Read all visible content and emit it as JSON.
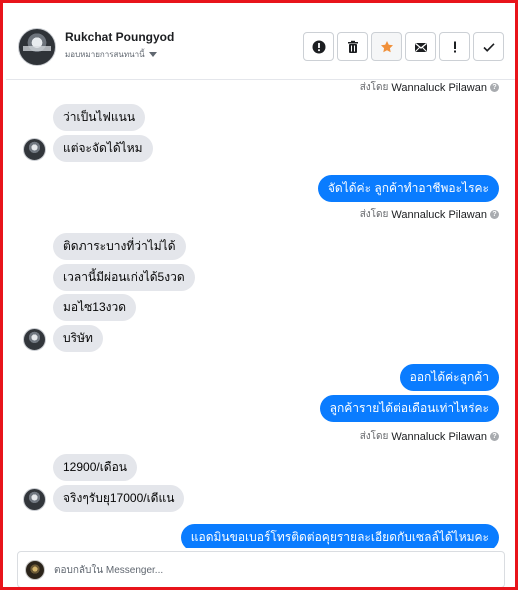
{
  "contact": {
    "name": "Rukchat Poungyod",
    "assign_label": "มอบหมายการสนทนานี้"
  },
  "toolbar": {
    "icons": [
      "alert-circle-icon",
      "trash-icon",
      "star-icon",
      "envelope-icon",
      "exclamation-icon",
      "check-icon"
    ],
    "accent_star": "#f0903a"
  },
  "thread": {
    "top_sent_by": {
      "prefix": "ส่งโดย",
      "name": "Wannaluck Pilawan"
    },
    "messages": [
      {
        "from": "customer",
        "text": "ว่าเป็นไฟแนน"
      },
      {
        "from": "customer",
        "text": "แต่จะจัดได้ไหม"
      },
      {
        "from": "page",
        "text": "จัดได้ค่ะ  ลูกค้าทำอาชีพอะไรคะ"
      },
      {
        "from": "customer",
        "text": "ติดภาระบางที่ว่าไม่ได้"
      },
      {
        "from": "customer",
        "text": "เวลานี้มีผ่อนเก่งได้5งวด"
      },
      {
        "from": "customer",
        "text": "มอไซ13งวด"
      },
      {
        "from": "customer",
        "text": "บริษัท"
      },
      {
        "from": "page",
        "text": "ออกได้ค่ะลูกค้า"
      },
      {
        "from": "page",
        "text": "ลูกค้ารายได้ต่อเดือนเท่าไหร่คะ"
      },
      {
        "from": "customer",
        "text": "12900/เดือน"
      },
      {
        "from": "customer",
        "text": "จริงๆรับยุ17000/เดีแน"
      },
      {
        "from": "page",
        "text": "แอดมินขอเบอร์โทรติดต่อคุยรายละเอียดกับเซลล์ได้ไหมคะ"
      }
    ],
    "sent_by": [
      {
        "prefix": "ส่งโดย",
        "name": "Wannaluck Pilawan"
      },
      {
        "prefix": "ส่งโดย",
        "name": "Wannaluck Pilawan"
      }
    ],
    "colors": {
      "outgoing": "#0a7cff",
      "incoming": "#e4e6eb"
    }
  },
  "composer": {
    "placeholder": "ตอบกลับใน Messenger..."
  }
}
